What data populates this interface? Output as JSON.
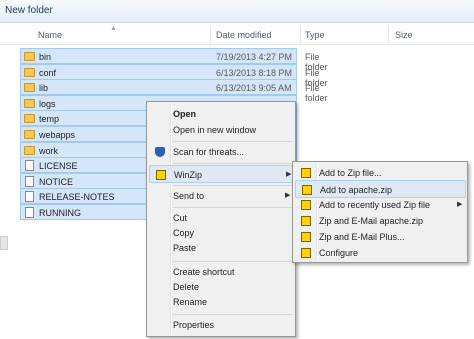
{
  "window": {
    "title": "New folder"
  },
  "columns": {
    "name": "Name",
    "date": "Date modified",
    "type": "Type",
    "size": "Size"
  },
  "files": [
    {
      "name": "bin",
      "date": "7/19/2013 4:27 PM",
      "type": "File folder",
      "kind": "folder",
      "selected": true
    },
    {
      "name": "conf",
      "date": "6/13/2013 8:18 PM",
      "type": "File folder",
      "kind": "folder",
      "selected": true
    },
    {
      "name": "lib",
      "date": "6/13/2013 9:05 AM",
      "type": "File folder",
      "kind": "folder",
      "selected": true
    },
    {
      "name": "logs",
      "date": "",
      "type": "",
      "kind": "folder",
      "selected": true
    },
    {
      "name": "temp",
      "date": "",
      "type": "",
      "kind": "folder",
      "selected": true
    },
    {
      "name": "webapps",
      "date": "",
      "type": "",
      "kind": "folder",
      "selected": true
    },
    {
      "name": "work",
      "date": "",
      "type": "",
      "kind": "folder",
      "selected": true
    },
    {
      "name": "LICENSE",
      "date": "",
      "type": "",
      "kind": "file",
      "selected": true
    },
    {
      "name": "NOTICE",
      "date": "",
      "type": "",
      "kind": "file",
      "selected": true
    },
    {
      "name": "RELEASE-NOTES",
      "date": "",
      "type": "",
      "kind": "file",
      "selected": true
    },
    {
      "name": "RUNNING",
      "date": "",
      "type": "",
      "kind": "file",
      "selected": true
    }
  ],
  "context_menu": {
    "open": "Open",
    "open_new_window": "Open in new window",
    "scan_threats": "Scan for threats...",
    "winzip": "WinZip",
    "send_to": "Send to",
    "cut": "Cut",
    "copy": "Copy",
    "paste": "Paste",
    "create_shortcut": "Create shortcut",
    "delete": "Delete",
    "rename": "Rename",
    "properties": "Properties"
  },
  "winzip_menu": {
    "add_to_zip": "Add to Zip file...",
    "add_to_apache": "Add to apache.zip",
    "add_recent": "Add to recently used Zip file",
    "zip_email_apache": "Zip and E-Mail apache.zip",
    "zip_email": "Zip and E-Mail Plus...",
    "configure": "Configure"
  },
  "icons": {
    "folder": "folder-icon",
    "file": "document-icon",
    "shield": "shield-icon",
    "winzip": "winzip-icon",
    "submenu": "chevron-right-icon"
  }
}
